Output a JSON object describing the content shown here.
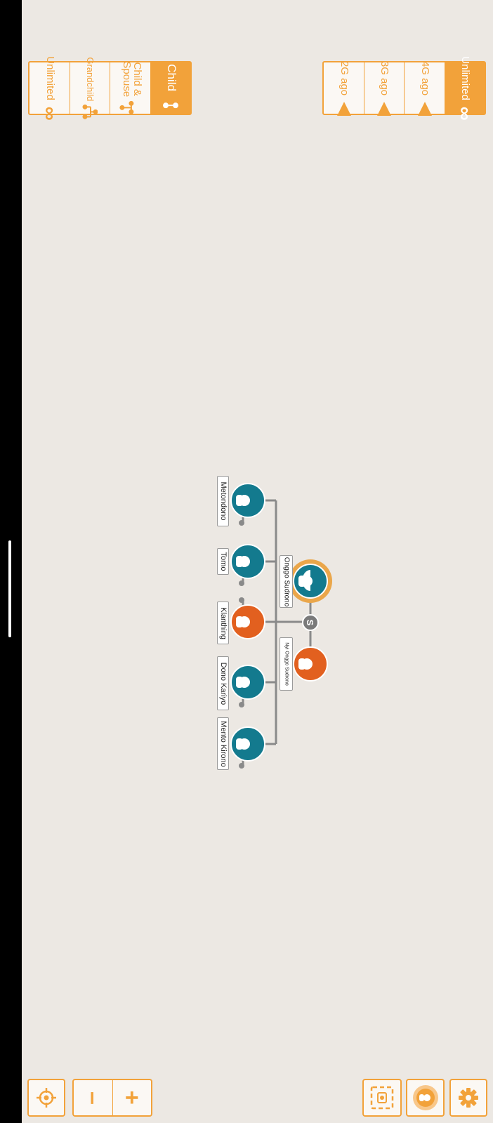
{
  "ancestors_filter": {
    "items": [
      {
        "label": "Unlimited",
        "icon": "infinity-icon",
        "active": true
      },
      {
        "label": "4G ago",
        "icon": "triangle-icon",
        "active": false
      },
      {
        "label": "3G ago",
        "icon": "triangle-icon",
        "active": false
      },
      {
        "label": "2G ago",
        "icon": "triangle-icon",
        "active": false
      }
    ]
  },
  "descendants_filter": {
    "items": [
      {
        "label": "Child",
        "icon": "child-tree-icon",
        "active": true
      },
      {
        "label": "Child &\nSpouse",
        "icon": "child-spouse-tree-icon",
        "active": false
      },
      {
        "label": "Grandchild",
        "icon": "grandchild-tree-icon",
        "active": false
      },
      {
        "label": "Unlimited",
        "icon": "infinity-icon",
        "active": false
      }
    ]
  },
  "tree": {
    "focus_person": {
      "name": "Onggo  Sudrono",
      "gender": "male"
    },
    "spouse": {
      "name": "Nyi Onggo Sudrono",
      "gender": "female"
    },
    "spouse_badge": "S",
    "children": [
      {
        "name": "Metondono",
        "gender": "male"
      },
      {
        "name": "Tomo",
        "gender": "male"
      },
      {
        "name": "Klanthing",
        "gender": "female"
      },
      {
        "name": "Dono  Kariyo",
        "gender": "male"
      },
      {
        "name": "Mento Kirono",
        "gender": "male"
      }
    ]
  },
  "controls": {
    "recenter_icon": "crosshair-icon",
    "zoom_out_label": "–",
    "zoom_in_label": "+",
    "screenshot_icon": "frame-capture-icon",
    "profile_icon": "person-focus-icon",
    "settings_icon": "gear-icon"
  },
  "colors": {
    "accent": "#f2a23a",
    "male": "#137a8e",
    "female": "#e2601f",
    "line": "#8a8a8a",
    "background": "#ece8e3"
  }
}
